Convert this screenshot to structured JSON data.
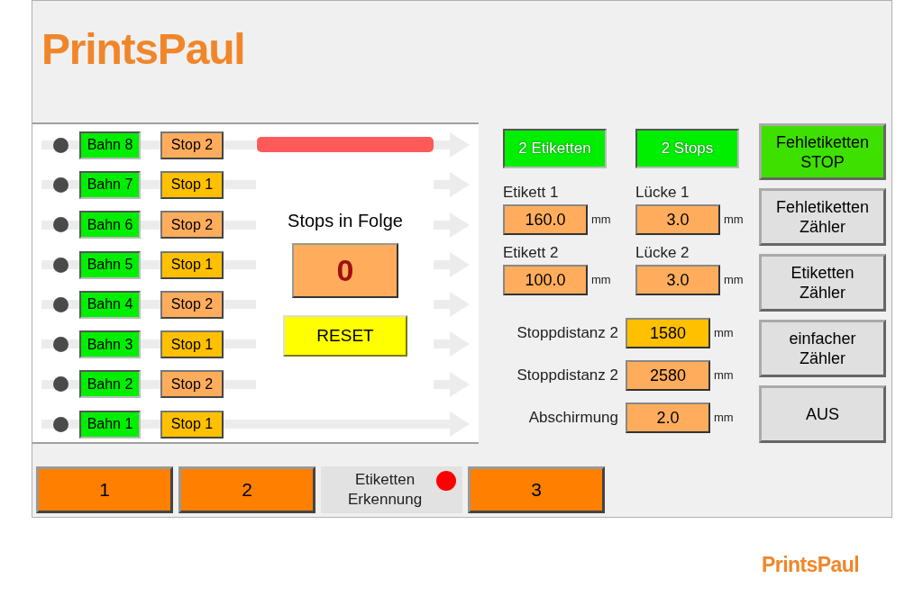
{
  "logo": "PrintsPaul",
  "lanes": [
    {
      "lane": "Bahn 8",
      "stop": "Stop 2",
      "color": "#ffad5c",
      "kind": "fault"
    },
    {
      "lane": "Bahn 7",
      "stop": "Stop 1",
      "color": "#ffc000",
      "kind": "idle"
    },
    {
      "lane": "Bahn 6",
      "stop": "Stop 2",
      "color": "#ffad5c",
      "kind": "idle"
    },
    {
      "lane": "Bahn 5",
      "stop": "Stop 1",
      "color": "#ffc000",
      "kind": "idle"
    },
    {
      "lane": "Bahn 4",
      "stop": "Stop 2",
      "color": "#ffad5c",
      "kind": "idle"
    },
    {
      "lane": "Bahn 3",
      "stop": "Stop 1",
      "color": "#ffc000",
      "kind": "idle"
    },
    {
      "lane": "Bahn 2",
      "stop": "Stop 2",
      "color": "#ffad5c",
      "kind": "idle"
    },
    {
      "lane": "Bahn 1",
      "stop": "Stop 1",
      "color": "#ffc000",
      "kind": "through"
    }
  ],
  "counter": {
    "title": "Stops in Folge",
    "value": "0"
  },
  "reset_button": "RESET",
  "mode_indicators": [
    {
      "label": "2 Etiketten"
    },
    {
      "label": "2 Stops"
    }
  ],
  "dimension_fields": [
    {
      "label": "Etikett 1",
      "value": "160.0",
      "unit": "mm"
    },
    {
      "label": "Lücke 1",
      "value": "3.0",
      "unit": "mm"
    },
    {
      "label": "Etikett 2",
      "value": "100.0",
      "unit": "mm"
    },
    {
      "label": "Lücke 2",
      "value": "3.0",
      "unit": "mm"
    }
  ],
  "stop_fields": [
    {
      "label": "Stoppdistanz 2",
      "value": "1580",
      "unit": "mm",
      "color": "#ffc000"
    },
    {
      "label": "Stoppdistanz 2",
      "value": "2580",
      "unit": "mm",
      "color": "#ffad5c"
    },
    {
      "label": "Abschirmung",
      "value": "2.0",
      "unit": "mm",
      "color": "#ffad5c"
    }
  ],
  "side_buttons": [
    {
      "label": "Fehletiketten\nSTOP",
      "active": true
    },
    {
      "label": "Fehletiketten\nZähler",
      "active": false
    },
    {
      "label": "Etiketten\nZähler",
      "active": false
    },
    {
      "label": "einfacher\nZähler",
      "active": false
    },
    {
      "label": "AUS",
      "active": false
    }
  ],
  "bottom_buttons": [
    {
      "label": "1"
    },
    {
      "label": "2"
    },
    {
      "label": "3"
    }
  ],
  "detection": {
    "label": "Etiketten\nErkennung",
    "color": "#ff0000"
  },
  "footer_logo": "PrintsPaul"
}
